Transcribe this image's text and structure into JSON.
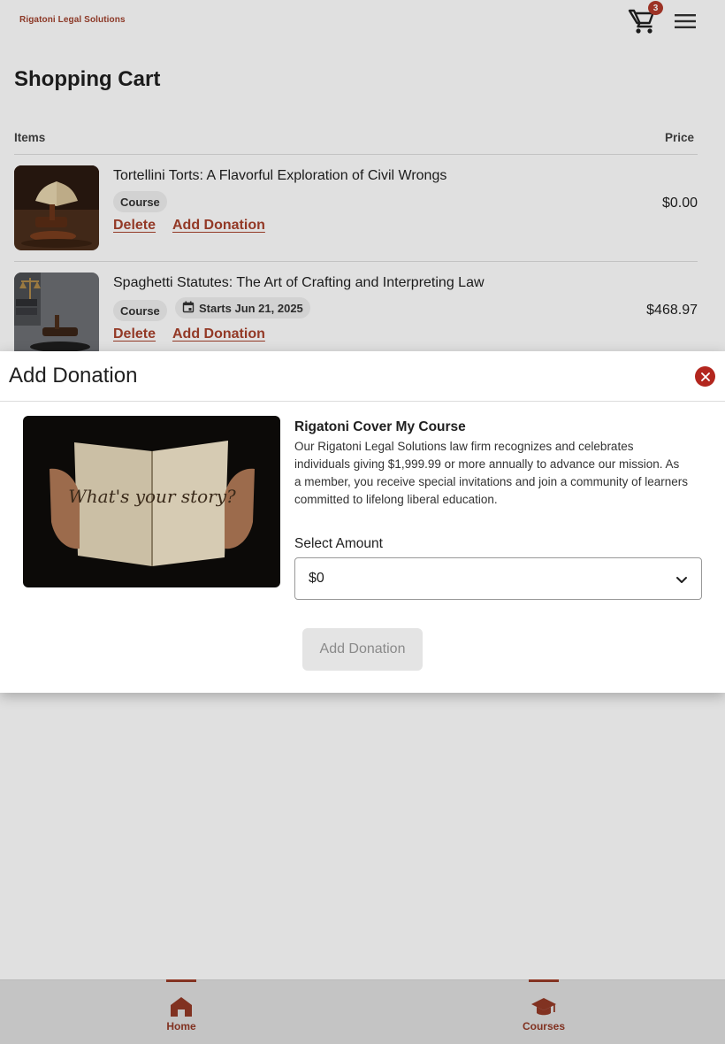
{
  "header": {
    "logo_text": "Rigatoni Legal Solutions",
    "cart_count": "3",
    "cart_icon": "shopping-cart-icon",
    "menu_icon": "hamburger-menu-icon"
  },
  "cart": {
    "title": "Shopping Cart",
    "columns": {
      "items": "Items",
      "price": "Price"
    },
    "items": [
      {
        "title": "Tortellini Torts: A Flavorful Exploration of Civil Wrongs",
        "tag": "Course",
        "price": "$0.00",
        "delete_label": "Delete",
        "donation_label": "Add Donation"
      },
      {
        "title": "Spaghetti Statutes: The Art of Crafting and Interpreting Law",
        "tag": "Course",
        "start": "Starts Jun 21, 2025",
        "price": "$468.97",
        "delete_label": "Delete",
        "donation_label": "Add Donation"
      }
    ]
  },
  "dialog": {
    "title": "Add Donation",
    "image_text": "What's your story?",
    "donation_title": "Rigatoni Cover My Course",
    "description": "Our Rigatoni Legal Solutions law firm recognizes and celebrates individuals giving $1,999.99 or more annually to advance our mission. As a member, you receive special invitations and join a community of learners committed to lifelong liberal education.",
    "amount_label": "Select Amount",
    "amount_value": "$0",
    "submit_label": "Add Donation"
  },
  "nav": {
    "items": [
      {
        "label": "Home",
        "icon": "home-icon"
      },
      {
        "label": "Courses",
        "icon": "graduation-cap-icon"
      }
    ]
  },
  "colors": {
    "brand": "#a8412c",
    "close": "#b3261e",
    "disabled_button": "#e4e4e4"
  }
}
